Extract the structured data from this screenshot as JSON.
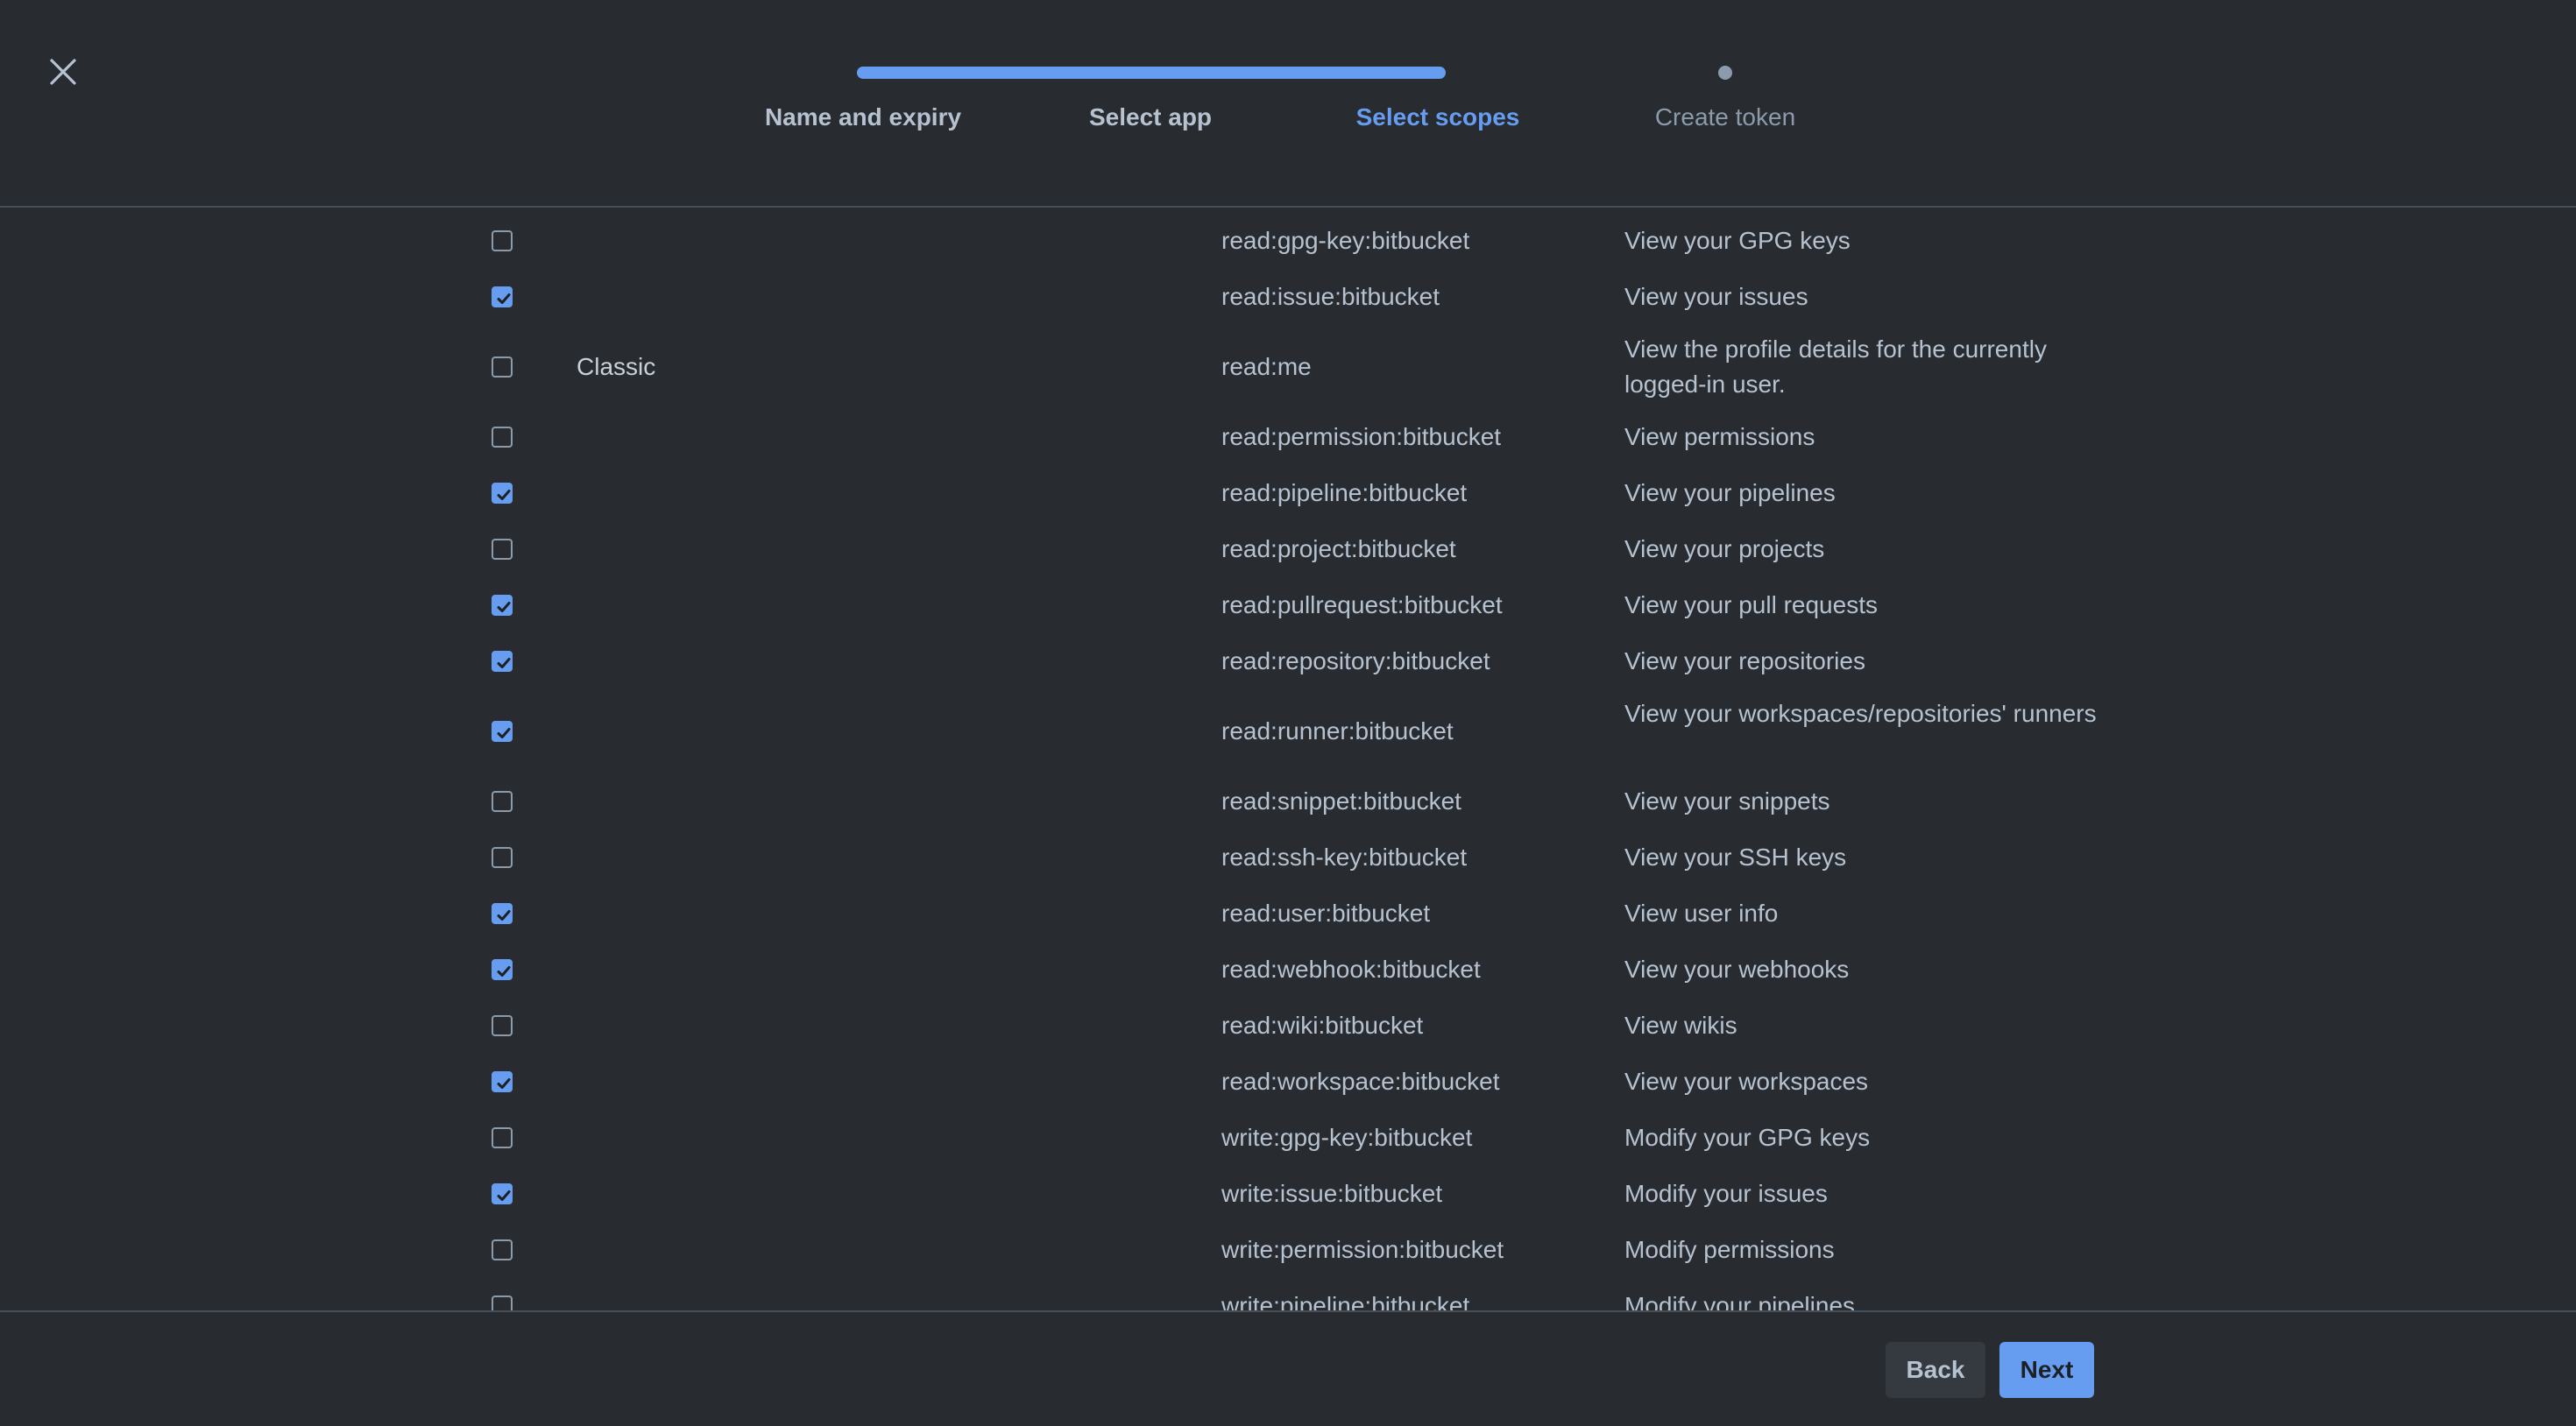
{
  "header": {
    "steps": [
      {
        "label": "Name and expiry",
        "state": "done"
      },
      {
        "label": "Select app",
        "state": "done"
      },
      {
        "label": "Select scopes",
        "state": "active"
      },
      {
        "label": "Create token",
        "state": "pending"
      }
    ]
  },
  "colors": {
    "background": "#282c31",
    "accent": "#669df1",
    "text": "#b6c2cf",
    "muted": "#8c9bab"
  },
  "icons": {
    "close": "close-icon",
    "checkbox_checked": "checkmark-icon"
  },
  "scopes": [
    {
      "checked": false,
      "app": "",
      "scope": "read:gpg-key:bitbucket",
      "description": "View your GPG keys"
    },
    {
      "checked": true,
      "app": "",
      "scope": "read:issue:bitbucket",
      "description": "View your issues"
    },
    {
      "checked": false,
      "app": "Classic",
      "scope": "read:me",
      "description": "View the profile details for the currently logged-in user."
    },
    {
      "checked": false,
      "app": "",
      "scope": "read:permission:bitbucket",
      "description": "View permissions"
    },
    {
      "checked": true,
      "app": "",
      "scope": "read:pipeline:bitbucket",
      "description": "View your pipelines"
    },
    {
      "checked": false,
      "app": "",
      "scope": "read:project:bitbucket",
      "description": "View your projects"
    },
    {
      "checked": true,
      "app": "",
      "scope": "read:pullrequest:bitbucket",
      "description": "View your pull requests"
    },
    {
      "checked": true,
      "app": "",
      "scope": "read:repository:bitbucket",
      "description": "View your repositories"
    },
    {
      "checked": true,
      "app": "",
      "scope": "read:runner:bitbucket",
      "description": "View your workspaces/repositories' runners"
    },
    {
      "checked": false,
      "app": "",
      "scope": "read:snippet:bitbucket",
      "description": "View your snippets"
    },
    {
      "checked": false,
      "app": "",
      "scope": "read:ssh-key:bitbucket",
      "description": "View your SSH keys"
    },
    {
      "checked": true,
      "app": "",
      "scope": "read:user:bitbucket",
      "description": "View user info"
    },
    {
      "checked": true,
      "app": "",
      "scope": "read:webhook:bitbucket",
      "description": "View your webhooks"
    },
    {
      "checked": false,
      "app": "",
      "scope": "read:wiki:bitbucket",
      "description": "View wikis"
    },
    {
      "checked": true,
      "app": "",
      "scope": "read:workspace:bitbucket",
      "description": "View your workspaces"
    },
    {
      "checked": false,
      "app": "",
      "scope": "write:gpg-key:bitbucket",
      "description": "Modify your GPG keys"
    },
    {
      "checked": true,
      "app": "",
      "scope": "write:issue:bitbucket",
      "description": "Modify your issues"
    },
    {
      "checked": false,
      "app": "",
      "scope": "write:permission:bitbucket",
      "description": "Modify permissions"
    },
    {
      "checked": false,
      "app": "",
      "scope": "write:pipeline:bitbucket",
      "description": "Modify your pipelines"
    }
  ],
  "footer": {
    "back_label": "Back",
    "next_label": "Next"
  }
}
